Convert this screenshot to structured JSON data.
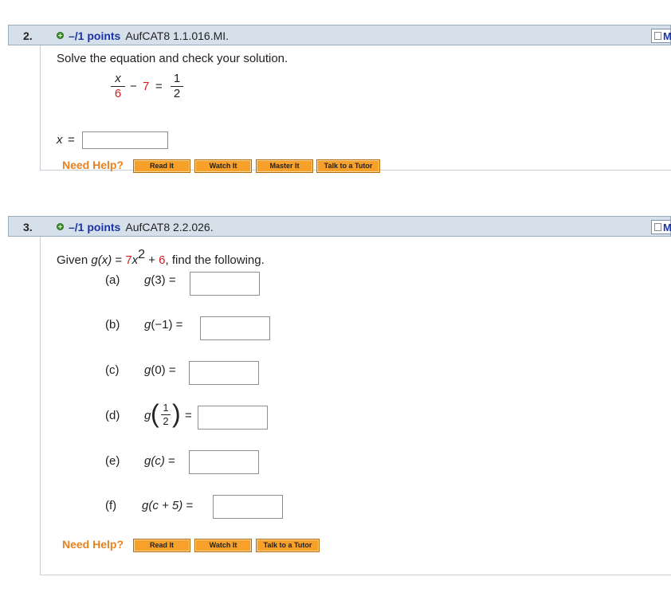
{
  "q2": {
    "number": "2.",
    "points": "–/1 points",
    "code": "AufCAT8 1.1.016.MI.",
    "my_label": "My",
    "instruction": "Solve the equation and check your solution.",
    "eq": {
      "x": "x",
      "den1": "6",
      "minus": "−",
      "seven": "7",
      "equals": "=",
      "one": "1",
      "two": "2"
    },
    "answer_label_var": "x",
    "answer_label_eq": "=",
    "need_help": "Need Help?",
    "buttons": [
      "Read It",
      "Watch It",
      "Master It",
      "Talk to a Tutor"
    ]
  },
  "q3": {
    "number": "3.",
    "points": "–/1 points",
    "code": "AufCAT8 2.2.026.",
    "my_label": "My",
    "given": {
      "pre": "Given ",
      "g": "g",
      "x": "(x)",
      "eq": " = ",
      "seven": "7",
      "xvar": "x",
      "exp": "2",
      "plus": " + ",
      "six": "6",
      "post": ",  find the following."
    },
    "parts": [
      {
        "label": "(a)",
        "g": "g",
        "arg": "(3)",
        "eq": "="
      },
      {
        "label": "(b)",
        "g": "g",
        "arg": "(−1)",
        "eq": "="
      },
      {
        "label": "(c)",
        "g": "g",
        "arg": "(0)",
        "eq": "="
      },
      {
        "label": "(d)",
        "g": "g",
        "frac_num": "1",
        "frac_den": "2",
        "eq": "="
      },
      {
        "label": "(e)",
        "g": "g",
        "arg": "(c)",
        "eq": "="
      },
      {
        "label": "(f)",
        "g": "g",
        "arg": "(c + 5)",
        "eq": "="
      }
    ],
    "need_help": "Need Help?",
    "buttons": [
      "Read It",
      "Watch It",
      "Talk to a Tutor"
    ]
  }
}
